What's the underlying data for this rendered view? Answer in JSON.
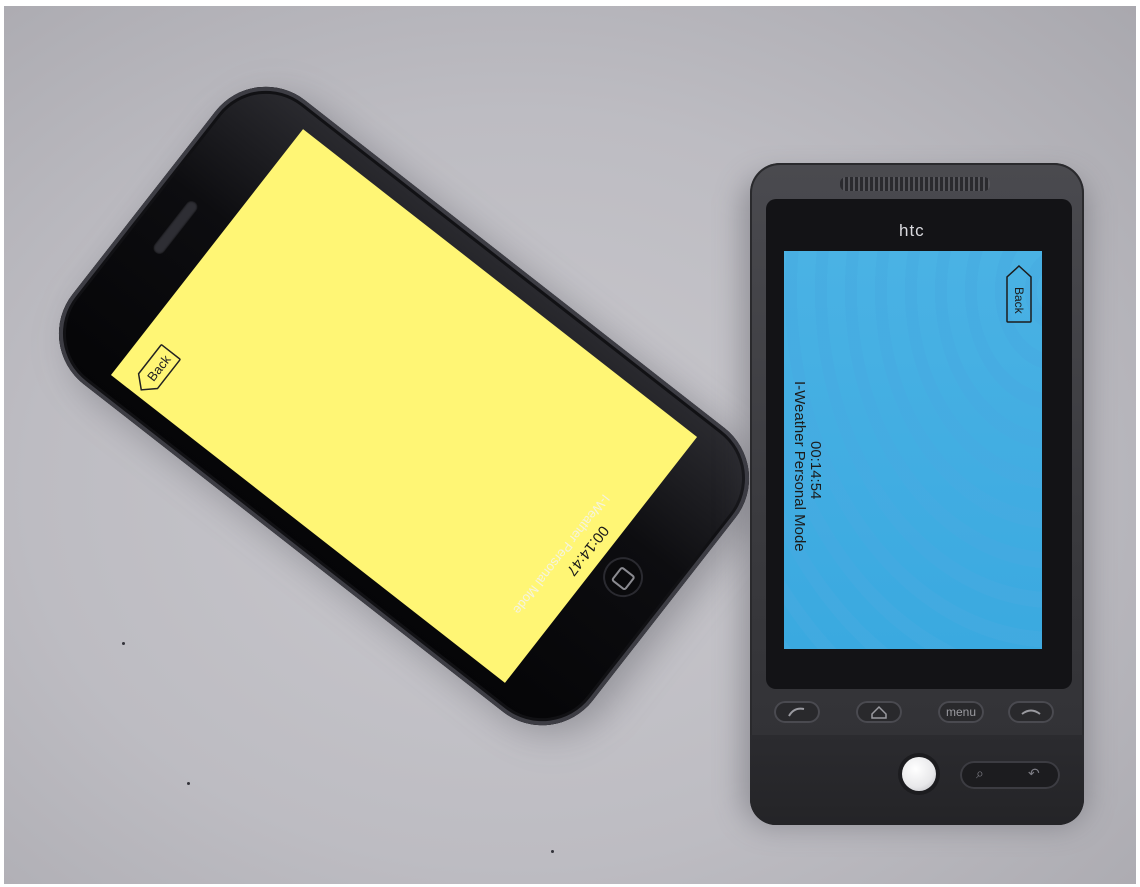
{
  "photo": {
    "background_color": "#c4c3c8"
  },
  "iphone": {
    "back_label": "Back",
    "clock": "00:14:47",
    "mode": "I-Weather Personal Mode",
    "screen_color": "#fff675"
  },
  "htc": {
    "brand": "htc",
    "back_label": "Back",
    "clock": "00:14:54",
    "mode": "I-Weather Personal Mode",
    "screen_color": "#3fadE2",
    "keys": {
      "menu_label": "menu"
    },
    "icons": [
      "call-icon",
      "home-icon",
      "menu-key",
      "end-call-icon",
      "search-icon",
      "back-arrow-icon"
    ]
  }
}
